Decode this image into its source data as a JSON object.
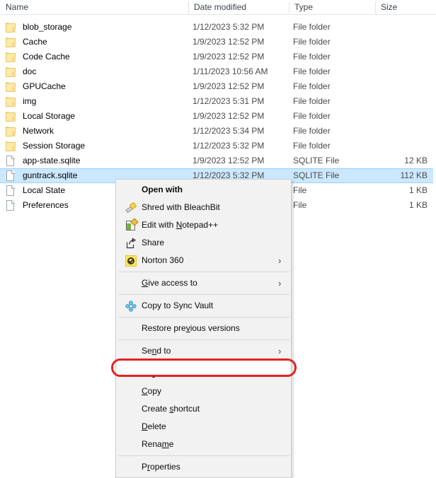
{
  "explorer": {
    "columns": [
      {
        "key": "name",
        "label": "Name"
      },
      {
        "key": "date",
        "label": "Date modified"
      },
      {
        "key": "type",
        "label": "Type"
      },
      {
        "key": "size",
        "label": "Size"
      }
    ],
    "rows": [
      {
        "icon": "folder-icon",
        "name": "blob_storage",
        "date": "1/12/2023 5:32 PM",
        "type": "File folder",
        "size": "",
        "selected": false
      },
      {
        "icon": "folder-icon",
        "name": "Cache",
        "date": "1/9/2023 12:52 PM",
        "type": "File folder",
        "size": "",
        "selected": false
      },
      {
        "icon": "folder-icon",
        "name": "Code Cache",
        "date": "1/9/2023 12:52 PM",
        "type": "File folder",
        "size": "",
        "selected": false
      },
      {
        "icon": "folder-icon",
        "name": "doc",
        "date": "1/11/2023 10:56 AM",
        "type": "File folder",
        "size": "",
        "selected": false
      },
      {
        "icon": "folder-icon",
        "name": "GPUCache",
        "date": "1/9/2023 12:52 PM",
        "type": "File folder",
        "size": "",
        "selected": false
      },
      {
        "icon": "folder-icon",
        "name": "img",
        "date": "1/12/2023 5:31 PM",
        "type": "File folder",
        "size": "",
        "selected": false
      },
      {
        "icon": "folder-icon",
        "name": "Local Storage",
        "date": "1/9/2023 12:52 PM",
        "type": "File folder",
        "size": "",
        "selected": false
      },
      {
        "icon": "folder-icon",
        "name": "Network",
        "date": "1/12/2023 5:34 PM",
        "type": "File folder",
        "size": "",
        "selected": false
      },
      {
        "icon": "folder-icon",
        "name": "Session Storage",
        "date": "1/12/2023 5:32 PM",
        "type": "File folder",
        "size": "",
        "selected": false
      },
      {
        "icon": "file-icon",
        "name": "app-state.sqlite",
        "date": "1/9/2023 12:52 PM",
        "type": "SQLITE File",
        "size": "12 KB",
        "selected": false
      },
      {
        "icon": "file-icon",
        "name": "guntrack.sqlite",
        "date": "1/12/2023 5:32 PM",
        "type": "SQLITE File",
        "size": "112 KB",
        "selected": true
      },
      {
        "icon": "file-icon",
        "name": "Local State",
        "date": "",
        "type": "File",
        "size": "1 KB",
        "selected": false
      },
      {
        "icon": "file-icon",
        "name": "Preferences",
        "date": "",
        "type": "File",
        "size": "1 KB",
        "selected": false
      }
    ]
  },
  "context_menu": {
    "items": [
      {
        "id": "open-with",
        "label": "Open with",
        "icon": null,
        "bold": true,
        "submenu": false,
        "separator_after": false,
        "accel": null
      },
      {
        "id": "shred-bleachbit",
        "label": "Shred with BleachBit",
        "icon": "bleachbit-icon",
        "bold": false,
        "submenu": false,
        "separator_after": false,
        "accel": null
      },
      {
        "id": "edit-notepadpp",
        "label": "Edit with Notepad++",
        "icon": "notepadpp-icon",
        "bold": false,
        "submenu": false,
        "separator_after": false,
        "accel": "N"
      },
      {
        "id": "share",
        "label": "Share",
        "icon": "share-icon",
        "bold": false,
        "submenu": false,
        "separator_after": false,
        "accel": null
      },
      {
        "id": "norton-360",
        "label": "Norton 360",
        "icon": "norton-icon",
        "bold": false,
        "submenu": true,
        "separator_after": true,
        "accel": null
      },
      {
        "id": "give-access-to",
        "label": "Give access to",
        "icon": null,
        "bold": false,
        "submenu": true,
        "separator_after": true,
        "accel": "G"
      },
      {
        "id": "copy-to-sync-vault",
        "label": "Copy to Sync Vault",
        "icon": "sync-vault-icon",
        "bold": false,
        "submenu": false,
        "separator_after": true,
        "accel": null
      },
      {
        "id": "restore-previous",
        "label": "Restore previous versions",
        "icon": null,
        "bold": false,
        "submenu": false,
        "separator_after": true,
        "accel": "v"
      },
      {
        "id": "send-to",
        "label": "Send to",
        "icon": null,
        "bold": false,
        "submenu": true,
        "separator_after": true,
        "accel": "n"
      },
      {
        "id": "cut",
        "label": "Cut",
        "icon": null,
        "bold": false,
        "submenu": false,
        "separator_after": false,
        "accel": "t"
      },
      {
        "id": "copy",
        "label": "Copy",
        "icon": null,
        "bold": false,
        "submenu": false,
        "separator_after": false,
        "accel": "C",
        "highlighted": true
      },
      {
        "id": "create-shortcut",
        "label": "Create shortcut",
        "icon": null,
        "bold": false,
        "submenu": false,
        "separator_after": false,
        "accel": "s"
      },
      {
        "id": "delete",
        "label": "Delete",
        "icon": null,
        "bold": false,
        "submenu": false,
        "separator_after": false,
        "accel": "D"
      },
      {
        "id": "rename",
        "label": "Rename",
        "icon": null,
        "bold": false,
        "submenu": false,
        "separator_after": true,
        "accel": "m"
      },
      {
        "id": "properties",
        "label": "Properties",
        "icon": null,
        "bold": false,
        "submenu": false,
        "separator_after": false,
        "accel": "r"
      }
    ],
    "submenu_arrow_glyph": "›"
  },
  "annotation": {
    "target_item": "Copy",
    "color": "#e02424"
  }
}
